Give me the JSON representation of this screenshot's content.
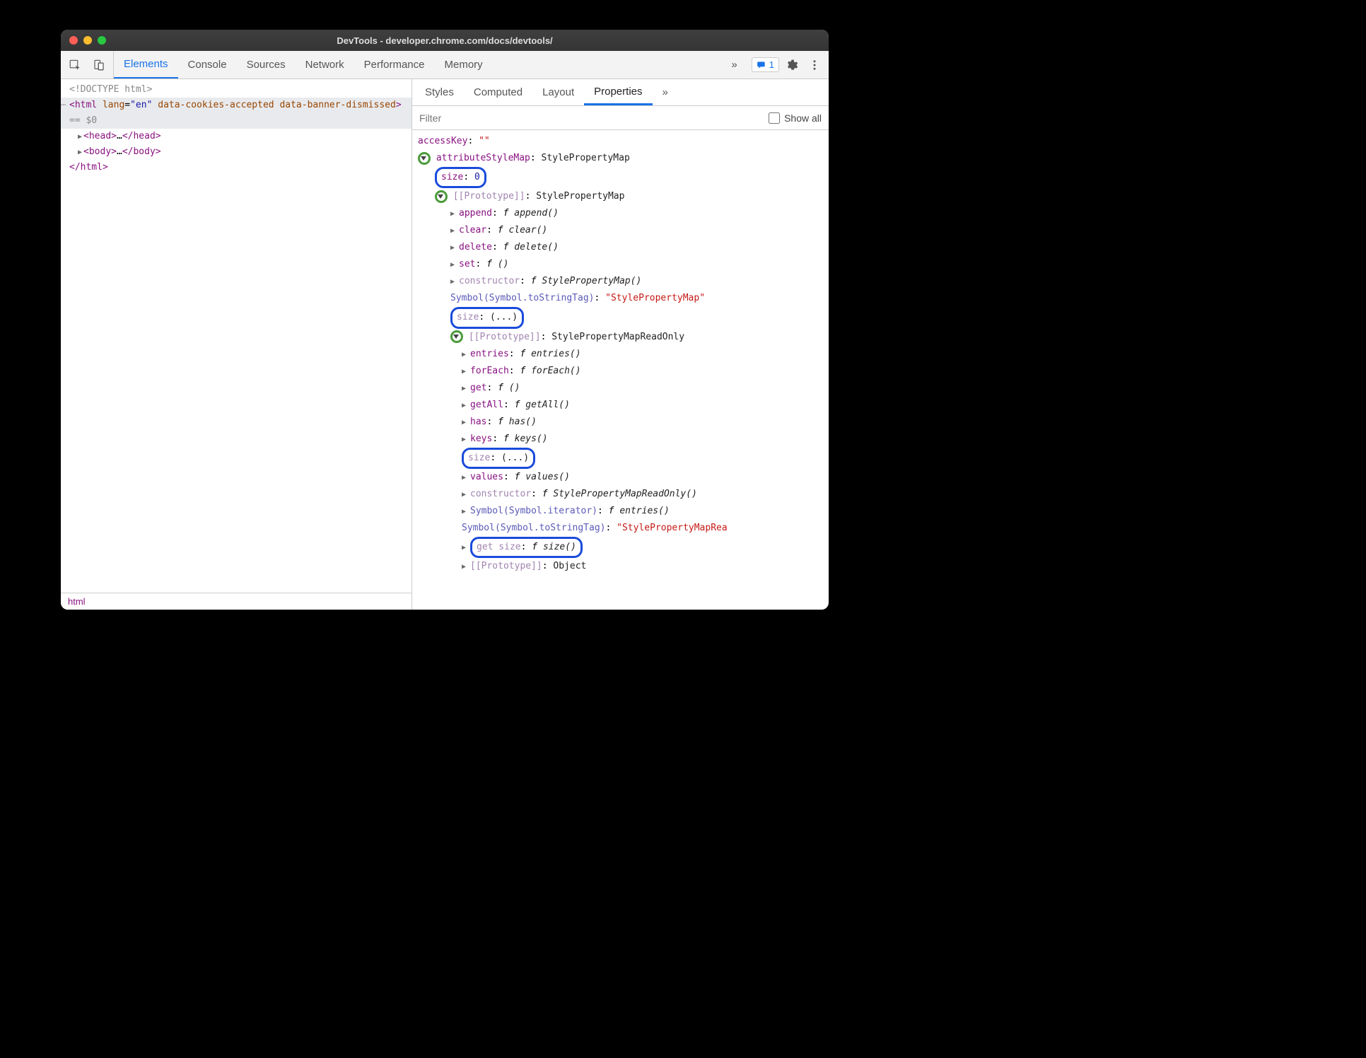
{
  "window": {
    "title": "DevTools - developer.chrome.com/docs/devtools/"
  },
  "toolbar": {
    "tabs": [
      "Elements",
      "Console",
      "Sources",
      "Network",
      "Performance",
      "Memory"
    ],
    "more": "»",
    "issues_count": "1"
  },
  "dom": {
    "doctype": "<!DOCTYPE html>",
    "html_open": "<html lang=\"en\" data-cookies-accepted data-banner-dismissed>",
    "html_hint": " == $0",
    "head": {
      "open": "<head>",
      "mid": "…",
      "close": "</head>"
    },
    "body": {
      "open": "<body>",
      "mid": "…",
      "close": "</body>"
    },
    "html_close": "</html>"
  },
  "breadcrumb": "html",
  "sidebar": {
    "tabs": [
      "Styles",
      "Computed",
      "Layout",
      "Properties"
    ],
    "more": "»",
    "active": "Properties"
  },
  "filter": {
    "placeholder": "Filter",
    "showall_label": "Show all"
  },
  "props": [
    {
      "indent": 0,
      "key": "accessKey",
      "sep": ": ",
      "val": "\"\"",
      "valClass": "p-str"
    },
    {
      "indent": 0,
      "expand": "green",
      "key": "attributeStyleMap",
      "sep": ": ",
      "val": "StylePropertyMap",
      "valClass": "p-obj"
    },
    {
      "indent": 1,
      "box": true,
      "key": "size",
      "sep": ": ",
      "val": "0",
      "valClass": "p-num"
    },
    {
      "indent": 1,
      "expand": "green",
      "key": "[[Prototype]]",
      "keyClass": "dim",
      "sep": ": ",
      "val": "StylePropertyMap",
      "valClass": "p-obj"
    },
    {
      "indent": 2,
      "tri": true,
      "key": "append",
      "sep": ": ",
      "fnsig": "append()"
    },
    {
      "indent": 2,
      "tri": true,
      "key": "clear",
      "sep": ": ",
      "fnsig": "clear()"
    },
    {
      "indent": 2,
      "tri": true,
      "key": "delete",
      "sep": ": ",
      "fnsig": "delete()"
    },
    {
      "indent": 2,
      "tri": true,
      "key": "set",
      "sep": ": ",
      "fnsig": "()"
    },
    {
      "indent": 2,
      "tri": true,
      "key": "constructor",
      "keyClass": "dim",
      "sep": ": ",
      "fnsig": "StylePropertyMap()"
    },
    {
      "indent": 2,
      "key": "Symbol(Symbol.toStringTag)",
      "keyClass": "p-sym",
      "rawKey": true,
      "sep": ": ",
      "val": "\"StylePropertyMap\"",
      "valClass": "p-str"
    },
    {
      "indent": 2,
      "box": true,
      "key": "size",
      "keyClass": "dim",
      "sep": ": ",
      "val": "(...)",
      "valClass": "p-obj"
    },
    {
      "indent": 2,
      "expand": "green",
      "key": "[[Prototype]]",
      "keyClass": "dim",
      "sep": ": ",
      "val": "StylePropertyMapReadOnly",
      "valClass": "p-obj"
    },
    {
      "indent": 3,
      "tri": true,
      "key": "entries",
      "sep": ": ",
      "fnsig": "entries()"
    },
    {
      "indent": 3,
      "tri": true,
      "key": "forEach",
      "sep": ": ",
      "fnsig": "forEach()"
    },
    {
      "indent": 3,
      "tri": true,
      "key": "get",
      "sep": ": ",
      "fnsig": "()"
    },
    {
      "indent": 3,
      "tri": true,
      "key": "getAll",
      "sep": ": ",
      "fnsig": "getAll()"
    },
    {
      "indent": 3,
      "tri": true,
      "key": "has",
      "sep": ": ",
      "fnsig": "has()"
    },
    {
      "indent": 3,
      "tri": true,
      "key": "keys",
      "sep": ": ",
      "fnsig": "keys()"
    },
    {
      "indent": 3,
      "box": true,
      "key": "size",
      "keyClass": "dim",
      "sep": ": ",
      "val": "(...)",
      "valClass": "p-obj"
    },
    {
      "indent": 3,
      "tri": true,
      "key": "values",
      "sep": ": ",
      "fnsig": "values()"
    },
    {
      "indent": 3,
      "tri": true,
      "key": "constructor",
      "keyClass": "dim",
      "sep": ": ",
      "fnsig": "StylePropertyMapReadOnly()"
    },
    {
      "indent": 3,
      "tri": true,
      "key": "Symbol(Symbol.iterator)",
      "keyClass": "p-sym",
      "rawKey": true,
      "sep": ": ",
      "fnsig": "entries()"
    },
    {
      "indent": 3,
      "key": "Symbol(Symbol.toStringTag)",
      "keyClass": "p-sym",
      "rawKey": true,
      "sep": ": ",
      "val": "\"StylePropertyMapRea",
      "valClass": "p-str",
      "overflow": true
    },
    {
      "indent": 3,
      "tri": true,
      "box": true,
      "key": "get size",
      "keyClass": "dim",
      "sep": ": ",
      "fnsig": "size()"
    },
    {
      "indent": 3,
      "tri": true,
      "key": "[[Prototype]]",
      "keyClass": "dim",
      "sep": ": ",
      "val": "Object",
      "valClass": "p-obj"
    }
  ]
}
